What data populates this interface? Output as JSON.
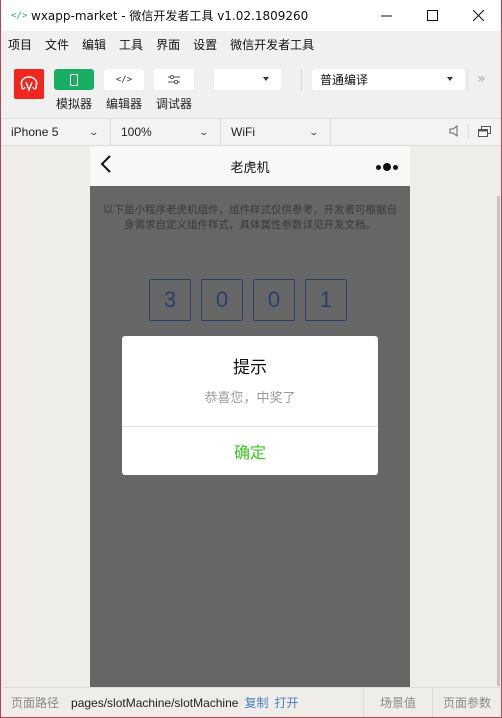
{
  "window": {
    "title": "wxapp-market - 微信开发者工具 v1.02.1809260",
    "app_icon": "</>",
    "controls": {
      "minimize": "—",
      "maximize": "☐",
      "close": "✕"
    }
  },
  "menubar": {
    "items": [
      "项目",
      "文件",
      "编辑",
      "工具",
      "界面",
      "设置",
      "微信开发者工具"
    ]
  },
  "toolbar": {
    "simulator_label": "模拟器",
    "editor_label": "编辑器",
    "debugger_label": "调试器",
    "simulator_icon": "▯",
    "editor_icon": "</>",
    "debugger_icon": "⚟",
    "mode_select_value": "",
    "compile_select_value": "普通编译",
    "more": "»"
  },
  "devicebar": {
    "device": "iPhone 5",
    "zoom": "100%",
    "network": "WiFi"
  },
  "phone": {
    "nav_title": "老虎机",
    "description": "以下是小程序老虎机组件，组件样式仅供参考，开发者可根据自身需求自定义组件样式，具体属性参数详见开发文档。",
    "slots": [
      "3",
      "0",
      "0",
      "1"
    ],
    "modal": {
      "title": "提示",
      "content": "恭喜您，中奖了",
      "confirm": "确定"
    }
  },
  "colors": {
    "accent_green": "#1aad64",
    "confirm_green": "#3cc51f",
    "logo_red": "#f0261f",
    "link_blue": "#4a7fc0"
  },
  "statusbar": {
    "label": "页面路径",
    "path": "pages/slotMachine/slotMachine",
    "copy": "复制",
    "open": "打开",
    "scene": "场景值",
    "params": "页面参数"
  }
}
